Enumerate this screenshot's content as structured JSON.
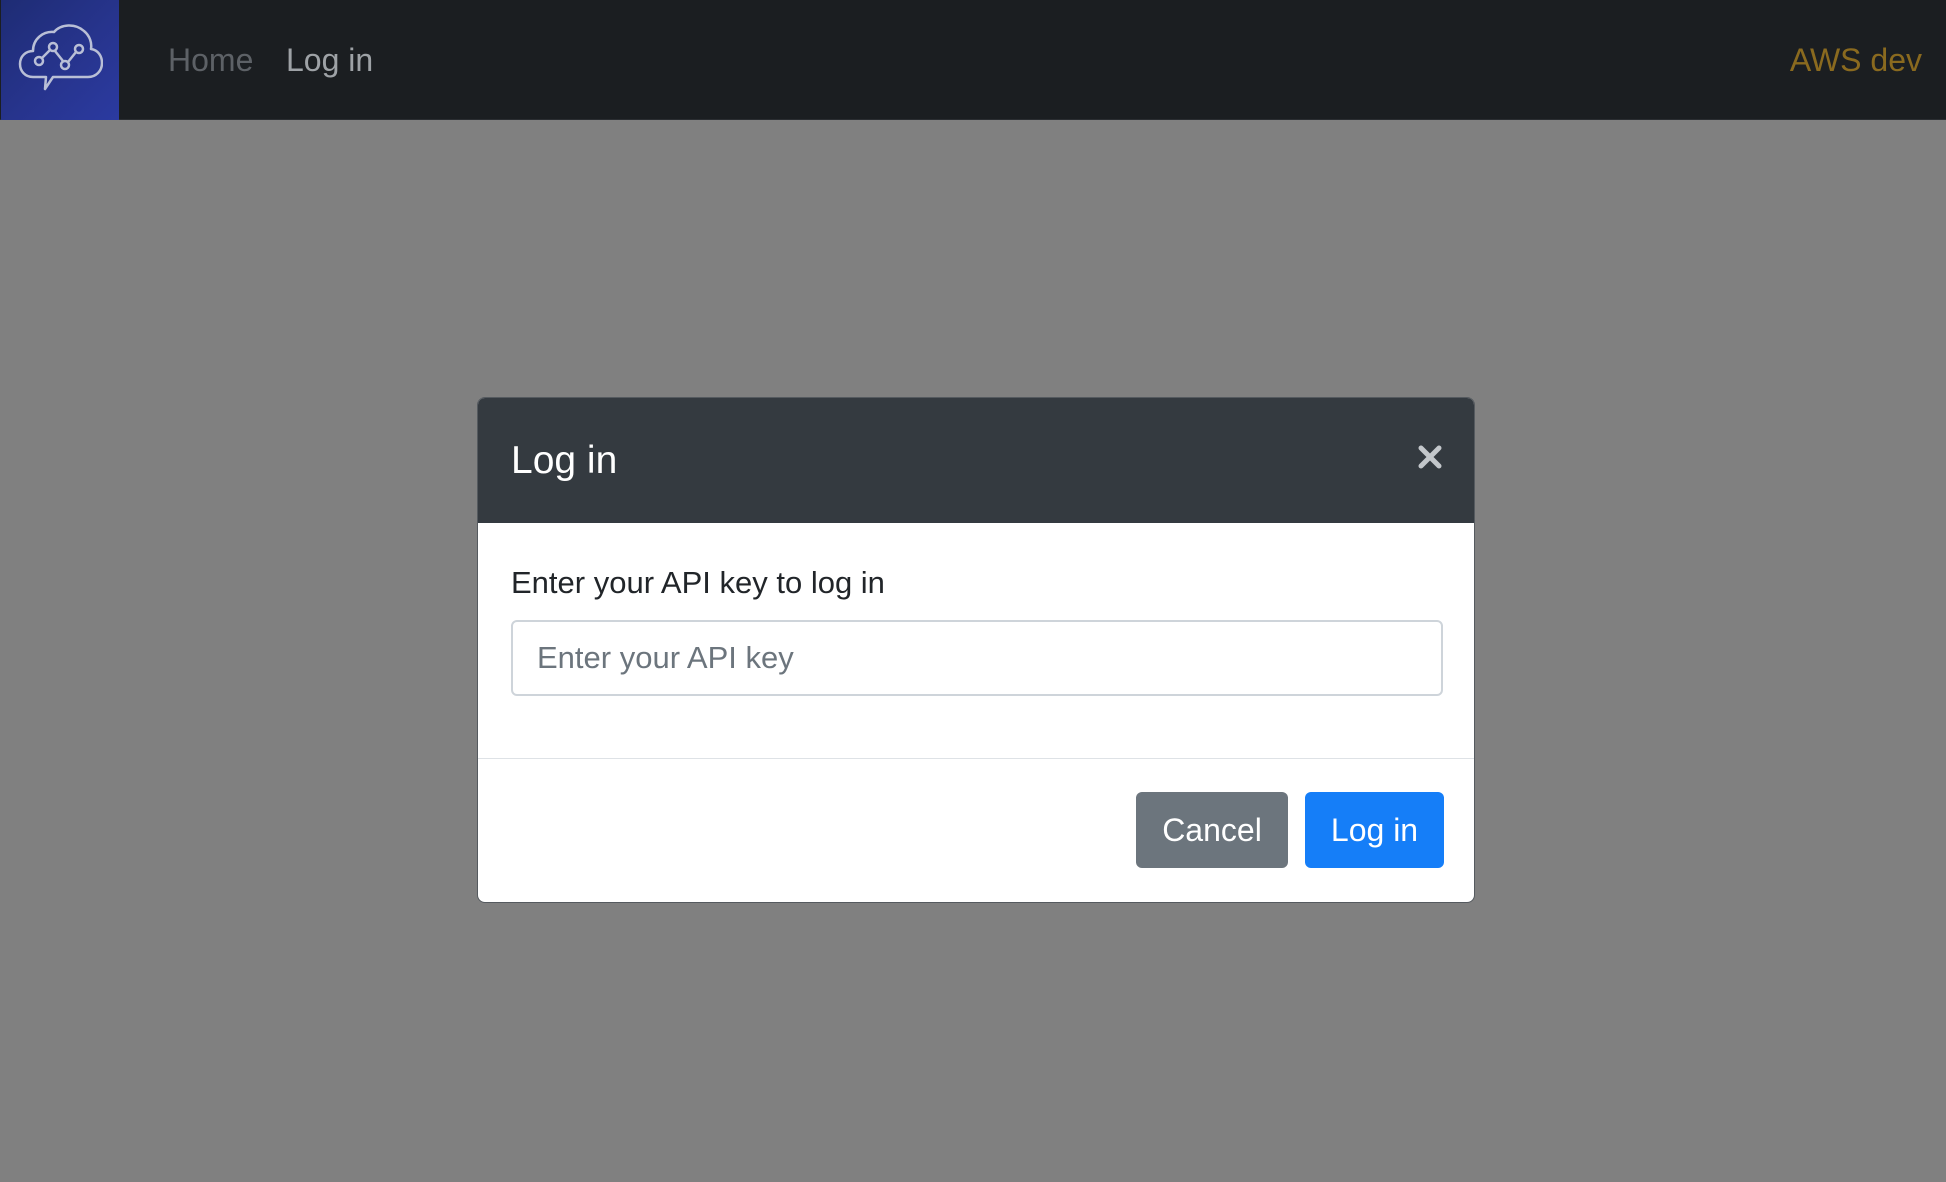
{
  "navbar": {
    "logo_icon": "cloud-graph-icon",
    "links": [
      {
        "label": "Home",
        "state": "inactive"
      },
      {
        "label": "Log in",
        "state": "active"
      }
    ],
    "environment": "AWS dev",
    "colors": {
      "background": "#1b1e21",
      "brand": "#27348d",
      "environment": "#8a6a1f"
    }
  },
  "modal": {
    "title": "Log in",
    "close_icon": "close-icon",
    "prompt": "Enter your API key to log in",
    "api_key_input": {
      "value": "",
      "placeholder": "Enter your API key"
    },
    "buttons": {
      "cancel_label": "Cancel",
      "login_label": "Log in"
    },
    "colors": {
      "header": "#343a40",
      "cancel": "#6c757d",
      "primary": "#157ef8"
    }
  },
  "backdrop_color": "#808080"
}
